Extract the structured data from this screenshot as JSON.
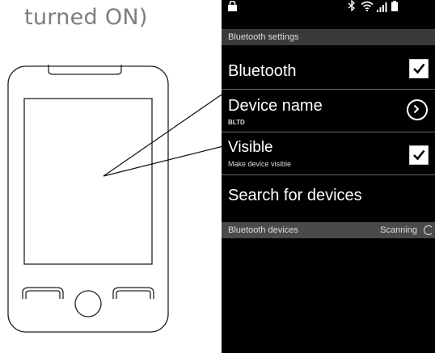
{
  "caption": {
    "text": "turned ON)"
  },
  "status_bar": {
    "icons": [
      "lock-icon",
      "bluetooth-icon",
      "wifi-icon",
      "signal-icon",
      "battery-icon"
    ]
  },
  "settings_header": "Bluetooth settings",
  "settings": [
    {
      "title": "Bluetooth",
      "control": "checkbox",
      "checked": true
    },
    {
      "title": "Device name",
      "subtitle": "BLTD",
      "control": "arrow"
    },
    {
      "title": "Visible",
      "subtitle": "Make device visible",
      "control": "checkbox",
      "checked": true
    },
    {
      "title": "Search for devices"
    }
  ],
  "devices_header": {
    "label": "Bluetooth devices",
    "status": "Scanning"
  },
  "colors": {
    "screen_bg": "#000000",
    "header_bg": "#3a3a3a",
    "caption": "#7d7d7d"
  }
}
